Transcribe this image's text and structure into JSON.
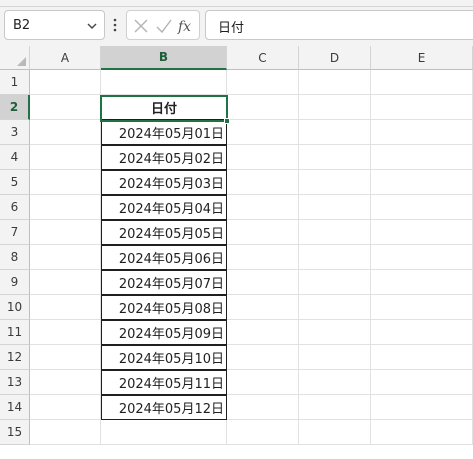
{
  "formula_bar": {
    "name_box": "B2",
    "content": "日付",
    "cancel_icon": "close-icon",
    "enter_icon": "check-icon",
    "function_icon": "fx-icon"
  },
  "columns": [
    "A",
    "B",
    "C",
    "D",
    "E"
  ],
  "rows": [
    "1",
    "2",
    "3",
    "4",
    "5",
    "6",
    "7",
    "8",
    "9",
    "10",
    "11",
    "12",
    "13",
    "14",
    "15"
  ],
  "active_cell": "B2",
  "table": {
    "header": "日付",
    "values": [
      "2024年05月01日",
      "2024年05月02日",
      "2024年05月03日",
      "2024年05月04日",
      "2024年05月05日",
      "2024年05月06日",
      "2024年05月07日",
      "2024年05月08日",
      "2024年05月09日",
      "2024年05月10日",
      "2024年05月11日",
      "2024年05月12日"
    ]
  },
  "colors": {
    "accent": "#217346",
    "header_bg": "#f3f3f3",
    "header_active_bg": "#d2d2d2",
    "gridline": "#e1e1e1",
    "table_border": "#1f1f1f"
  }
}
